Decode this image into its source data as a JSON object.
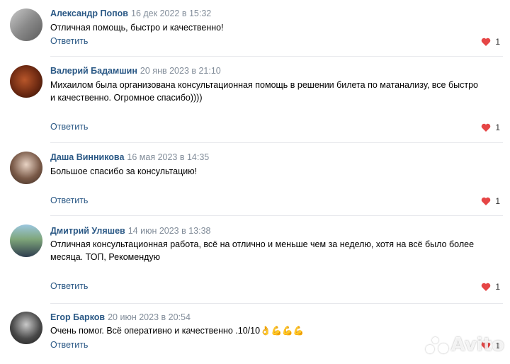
{
  "comments": [
    {
      "author": "Александр Попов",
      "date": "16 дек 2022 в 15:32",
      "text": "Отличная помощь, быстро и качественно!",
      "reply_label": "Ответить",
      "likes": "1"
    },
    {
      "author": "Валерий Бадамшин",
      "date": "20 янв 2023 в 21:10",
      "text": "Михаилом была организована консультационная помощь в решении билета по матанализу, все быстро и качественно. Огромное спасибо))))",
      "reply_label": "Ответить",
      "likes": "1"
    },
    {
      "author": "Даша Винникова",
      "date": "16 мая 2023 в 14:35",
      "text": "Большое спасибо за консультацию!",
      "reply_label": "Ответить",
      "likes": "1"
    },
    {
      "author": "Дмитрий Уляшев",
      "date": "14 июн 2023 в 13:38",
      "text": "Отличная консультационная работа, всё на отлично и меньше чем за неделю, хотя на всё было более месяца. ТОП, Рекомендую",
      "reply_label": "Ответить",
      "likes": "1"
    },
    {
      "author": "Егор Барков",
      "date": "20 июн 2023 в 20:54",
      "text": "Очень помог. Всё оперативно и качественно .10/10",
      "emoji": "👌💪💪💪",
      "reply_label": "Ответить",
      "likes": "1"
    }
  ],
  "watermark": "Avito",
  "colors": {
    "author": "#2a5885",
    "date": "#818c99",
    "like_heart": "#e64646",
    "divider": "#e7e8ec"
  }
}
